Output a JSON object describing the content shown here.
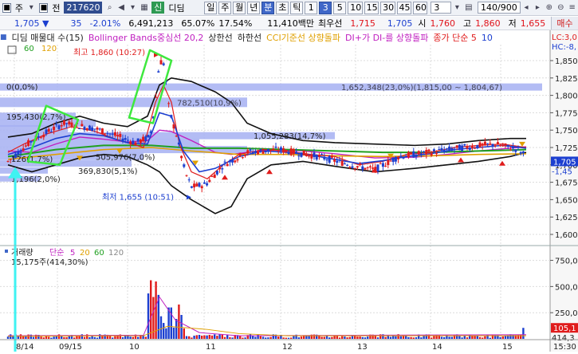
{
  "toolbar": {
    "type_label": "주",
    "jeon_label": "전",
    "code": "217620",
    "stock_name": "디딤",
    "stock_tag": "신",
    "periods": [
      "일",
      "주",
      "월",
      "년",
      "분",
      "초",
      "틱",
      "1",
      "3",
      "5",
      "10",
      "15",
      "30",
      "45",
      "60"
    ],
    "selected_periods": [
      "분",
      "3"
    ],
    "interval_value": "3",
    "count": "140/900"
  },
  "info": {
    "price": "1,705",
    "direction_icon": "down-triangle-icon",
    "change": "35",
    "change_pct": "-2.01%",
    "volume": "6,491,213",
    "ratio1": "65.07%",
    "ratio2": "17.54%",
    "amount": "11,410백만",
    "best_ask_label": "최우선",
    "best_ask": "1,715",
    "best_bid": "1,705",
    "open_label": "시",
    "open": "1,760",
    "high_label": "고",
    "high": "1,860",
    "low_label": "저",
    "low": "1,655",
    "buy_button": "매수"
  },
  "legend": {
    "items": [
      {
        "text": "디딤 매물대 수(15)",
        "color": "#222222"
      },
      {
        "text": "Bollinger Bands중심선 20,2",
        "color": "#c020c0"
      },
      {
        "text": "상한선",
        "color": "#222222"
      },
      {
        "text": "하한선",
        "color": "#222222"
      },
      {
        "text": "CCI기준선 상향돌파",
        "color": "#e0a000"
      },
      {
        "text": "DI+가 DI-를 상향돌파",
        "color": "#c020c0"
      },
      {
        "text": "종가 단순 5",
        "color": "#e01c1c"
      },
      {
        "text": "10",
        "color": "#1c3fd0"
      }
    ],
    "ma_extra": [
      {
        "text": "60",
        "color": "#20a020"
      },
      {
        "text": "120",
        "color": "#e0a000"
      }
    ],
    "right_labels": [
      "LC:3,0",
      "HC:-8,"
    ]
  },
  "volume_legend": {
    "title": "거래량",
    "ma_label": "단순",
    "periods": [
      {
        "text": "5",
        "color": "#c020c0"
      },
      {
        "text": "20",
        "color": "#e0a000"
      },
      {
        "text": "60",
        "color": "#20a020"
      },
      {
        "text": "120",
        "color": "#888888"
      }
    ],
    "value": "15,175주(414,30%)"
  },
  "annotations": {
    "high": "최고 1,860 (10:27)",
    "low": "최저 1,655 (10:51)",
    "profile_top": "0(0,0%)",
    "profile_1": "1,652,348(23,0%)(1,815,00 ~ 1,804,67)",
    "profile_2": "782,510(10,9%)",
    "profile_3": "1,055,283(14,7%)",
    "profile_4": "505,976(7,0%)",
    "profile_5": "369,830(5,1%)",
    "profile_6": "1,196(2,0%)",
    "profile_7": "195,430(2,7%)",
    "profile_8": "126(1,7%)"
  },
  "price_axis": {
    "ticks": [
      "1,850",
      "1,825",
      "1,800",
      "1,775",
      "1,750",
      "1,725",
      "1,700",
      "1,675",
      "1,650",
      "1,625",
      "1,600"
    ],
    "current": "1,705",
    "current_sub": "-1,45"
  },
  "volume_axis": {
    "ticks": [
      "750,00",
      "500,00",
      "250,00"
    ],
    "current": "105,1",
    "current_sub": "414,3"
  },
  "time_axis": {
    "labels": [
      "8/14",
      "09/15",
      "10",
      "11",
      "12",
      "13",
      "14",
      "15"
    ],
    "last": "15:30"
  },
  "colors": {
    "up": "#e01c1c",
    "down": "#1c3fd0",
    "profile": "#9aa6f0",
    "highlight_green": "#3ee83e",
    "arrow_cyan": "#3ff2f2"
  }
}
